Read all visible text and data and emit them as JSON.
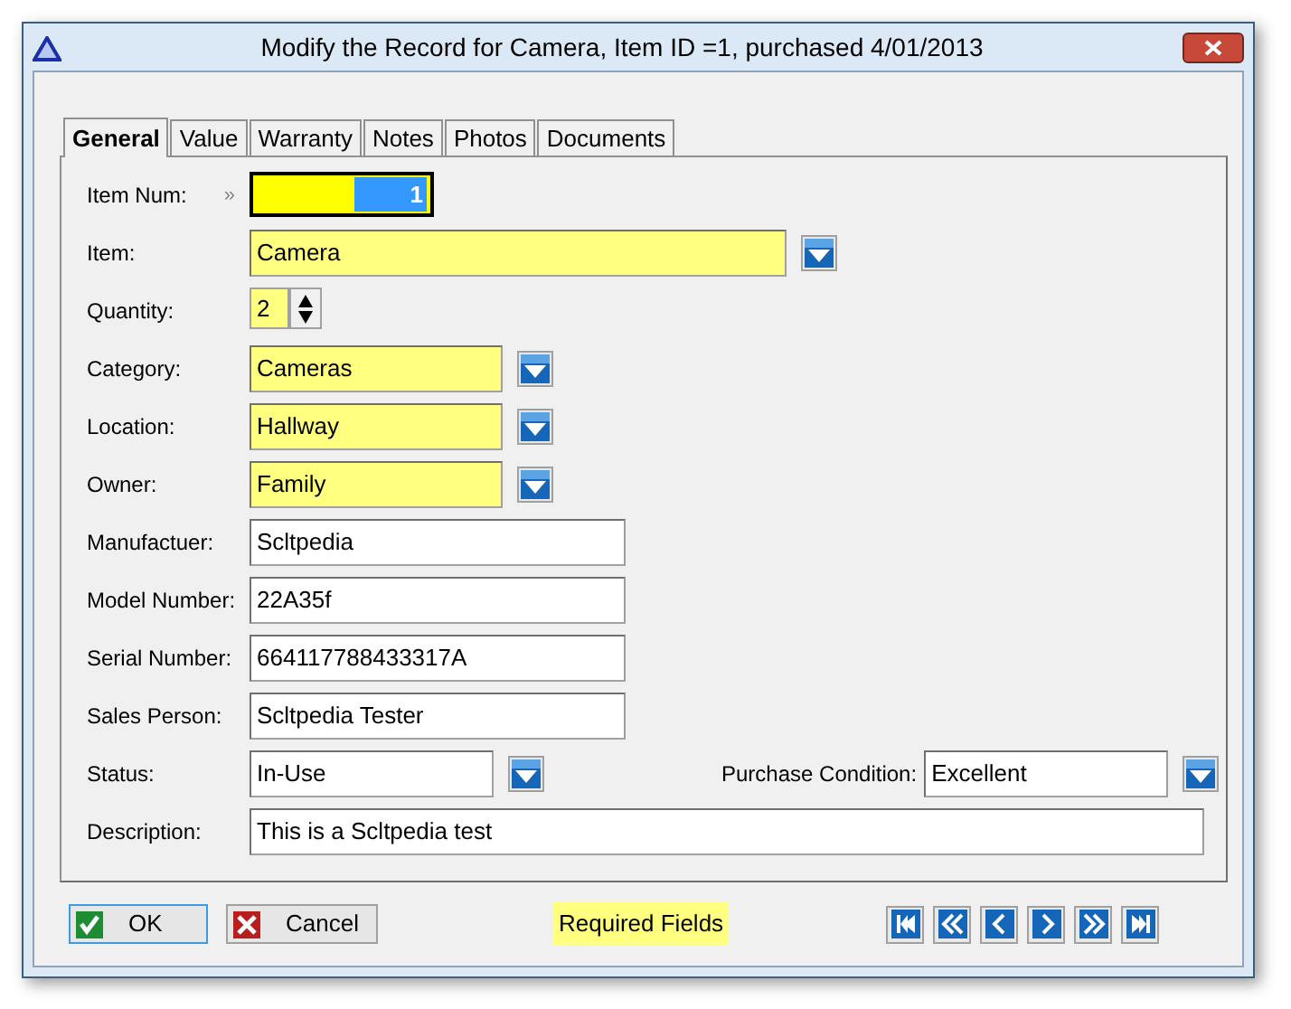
{
  "window": {
    "title": "Modify the Record for Camera, Item ID =1, purchased 4/01/2013"
  },
  "tabs": [
    {
      "label": "General",
      "selected": true
    },
    {
      "label": "Value",
      "selected": false
    },
    {
      "label": "Warranty",
      "selected": false
    },
    {
      "label": "Notes",
      "selected": false
    },
    {
      "label": "Photos",
      "selected": false
    },
    {
      "label": "Documents",
      "selected": false
    }
  ],
  "form": {
    "rows": [
      {
        "fields": [
          {
            "label": "Item Num:",
            "kind": "number",
            "marker": "»",
            "value": "1",
            "required": true,
            "text_selected": true
          }
        ]
      },
      {
        "fields": [
          {
            "label": "Item:",
            "kind": "combo",
            "value": "Camera",
            "required": true
          }
        ]
      },
      {
        "fields": [
          {
            "label": "Quantity:",
            "kind": "spin",
            "value": "2",
            "required": true
          }
        ]
      },
      {
        "fields": [
          {
            "label": "Category:",
            "kind": "combo",
            "value": "Cameras",
            "required": true
          }
        ]
      },
      {
        "fields": [
          {
            "label": "Location:",
            "kind": "combo",
            "value": "Hallway",
            "required": true
          }
        ]
      },
      {
        "fields": [
          {
            "label": "Owner:",
            "kind": "combo",
            "value": "Family",
            "required": true
          }
        ]
      },
      {
        "fields": [
          {
            "label": "Manufactuer:",
            "kind": "text",
            "value": "Scltpedia",
            "required": false
          }
        ]
      },
      {
        "fields": [
          {
            "label": "Model Number:",
            "kind": "text",
            "value": "22A35f",
            "required": false
          }
        ]
      },
      {
        "fields": [
          {
            "label": "Serial Number:",
            "kind": "text",
            "value": "664117788433317A",
            "required": false
          }
        ]
      },
      {
        "fields": [
          {
            "label": "Sales Person:",
            "kind": "text",
            "value": "Scltpedia Tester",
            "required": false
          }
        ]
      },
      {
        "fields": [
          {
            "label": "Status:",
            "kind": "combo",
            "value": "In-Use",
            "required": false
          },
          {
            "label": "Purchase Condition:",
            "kind": "combo",
            "value": "Excellent",
            "required": false
          }
        ]
      },
      {
        "fields": [
          {
            "label": "Description:",
            "kind": "memo",
            "value": "This is a Scltpedia test",
            "required": false
          }
        ]
      }
    ]
  },
  "buttons": [
    {
      "label": "OK",
      "kind": "ok",
      "focused": true
    },
    {
      "label": "Cancel",
      "kind": "cancel",
      "focused": false
    }
  ],
  "legend": {
    "label": "Required Fields"
  },
  "navigation": [
    {
      "kind": "first"
    },
    {
      "kind": "prev_page"
    },
    {
      "kind": "prev"
    },
    {
      "kind": "next"
    },
    {
      "kind": "next_page"
    },
    {
      "kind": "last"
    }
  ]
}
